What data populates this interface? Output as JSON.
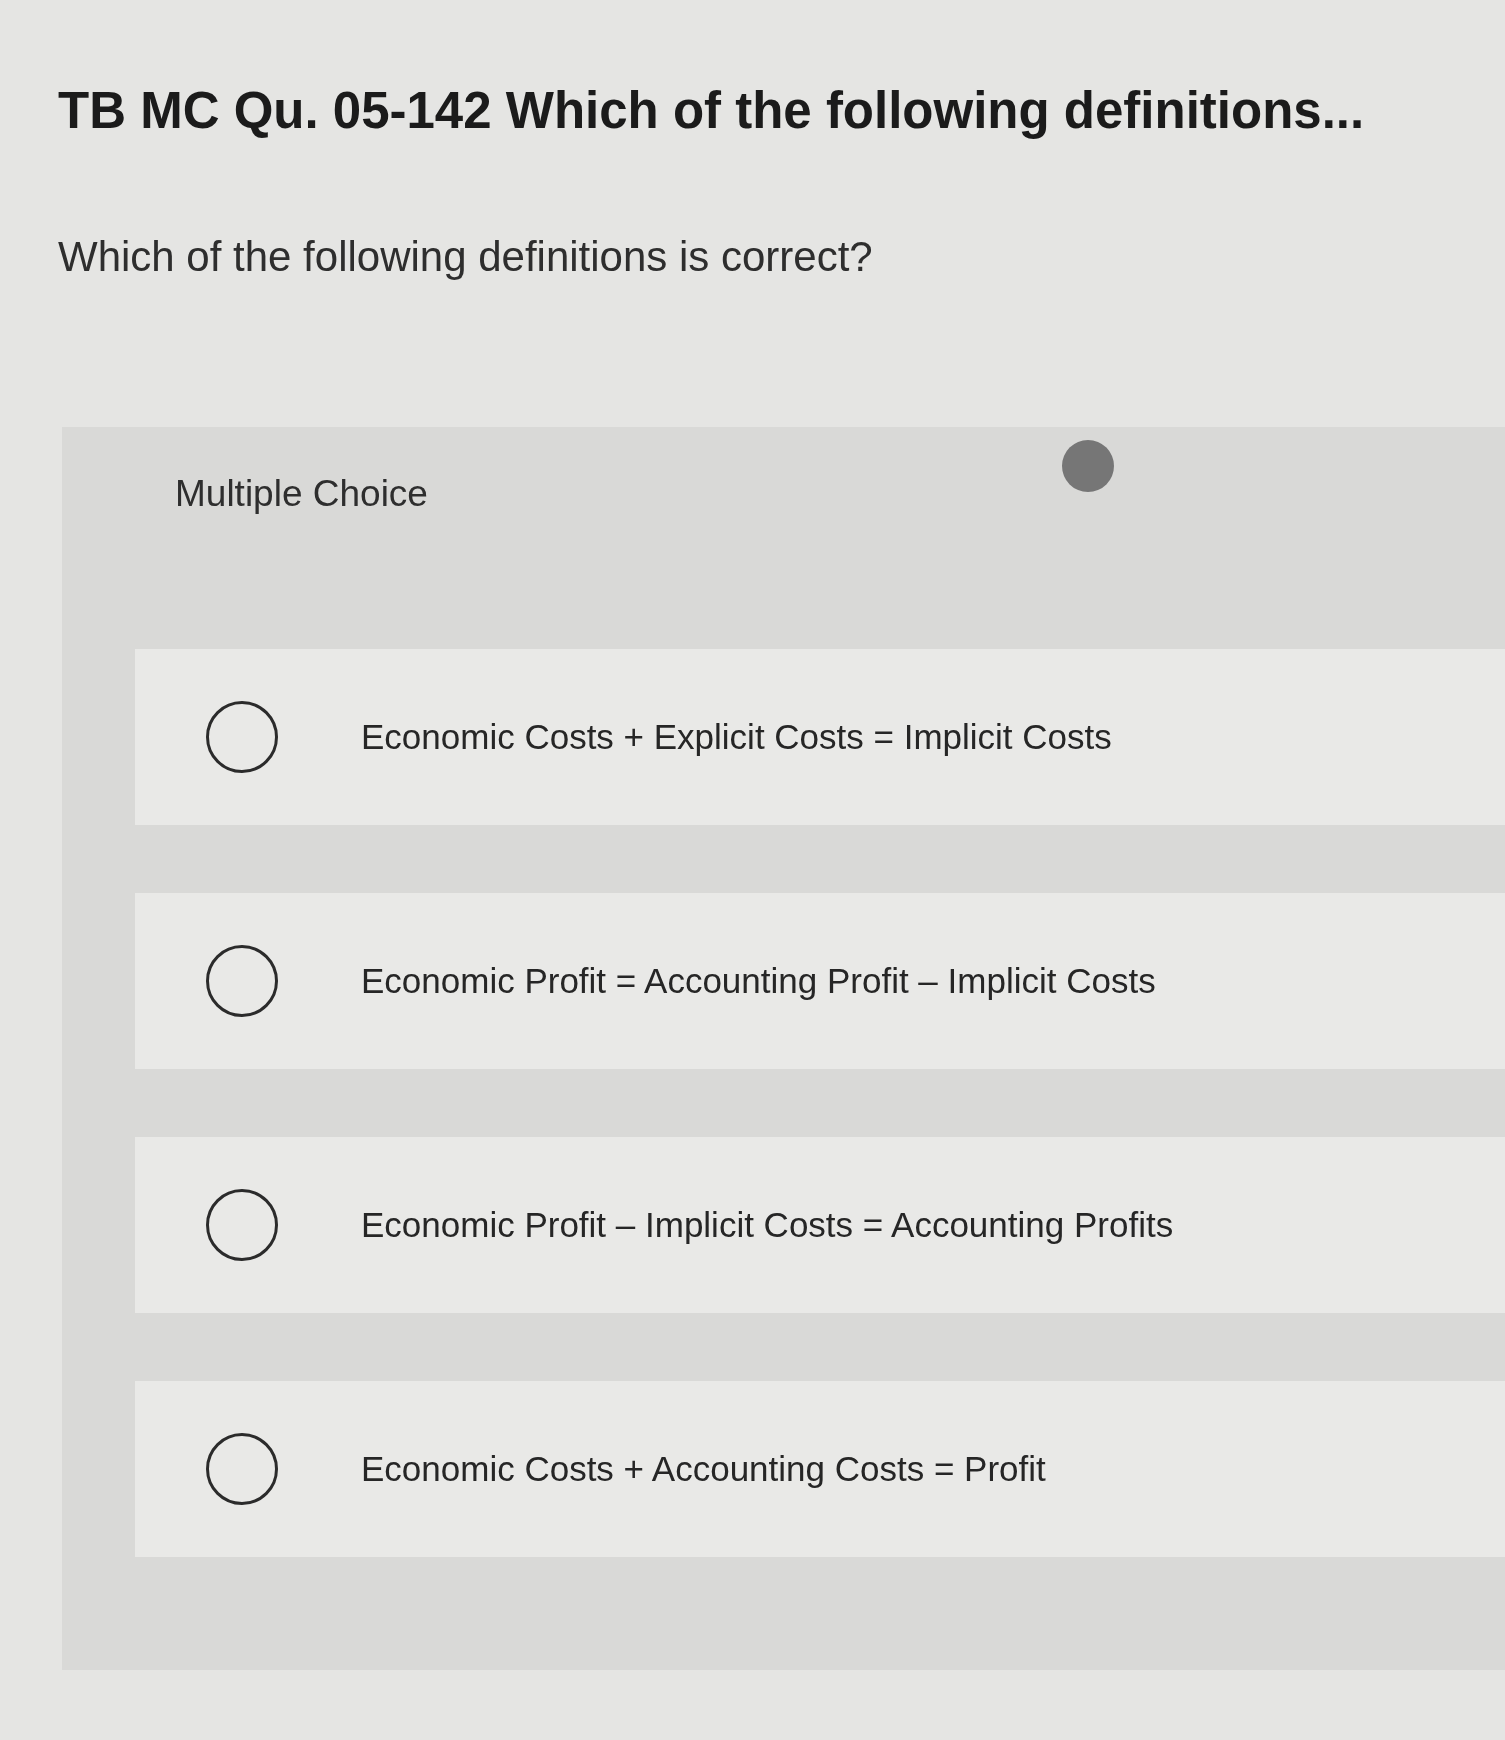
{
  "title": "TB MC Qu. 05-142 Which of the following definitions...",
  "question": "Which of the following definitions is correct?",
  "answer_panel": {
    "label": "Multiple Choice",
    "options": [
      {
        "text": "Economic Costs + Explicit Costs = Implicit Costs",
        "selected": false
      },
      {
        "text": "Economic Profit = Accounting Profit – Implicit Costs",
        "selected": false
      },
      {
        "text": "Economic Profit – Implicit Costs = Accounting Profits",
        "selected": false
      },
      {
        "text": "Economic Costs + Accounting Costs = Profit",
        "selected": false
      }
    ]
  }
}
